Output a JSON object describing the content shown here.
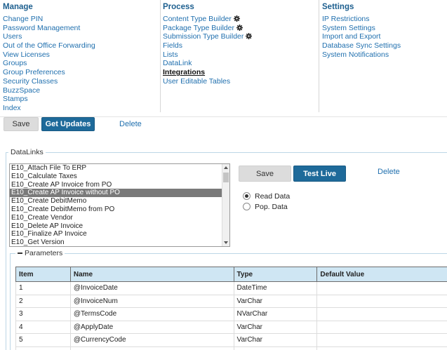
{
  "nav": {
    "manage": {
      "heading": "Manage",
      "items": [
        "Change PIN",
        "Password Management",
        "Users",
        "Out of the Office Forwarding",
        "View Licenses",
        "Groups",
        "Group Preferences",
        "Security Classes",
        "BuzzSpace",
        "Stamps",
        "Index"
      ]
    },
    "process": {
      "heading": "Process",
      "items": [
        {
          "label": "Content Type Builder",
          "icon": "gear-icon"
        },
        {
          "label": "Package Type Builder",
          "icon": "gear-icon"
        },
        {
          "label": "Submission Type Builder",
          "icon": "gear-icon"
        },
        {
          "label": "Fields"
        },
        {
          "label": "Lists"
        },
        {
          "label": "DataLink"
        },
        {
          "label": "Integrations",
          "active": true
        },
        {
          "label": "User Editable Tables"
        }
      ]
    },
    "settings": {
      "heading": "Settings",
      "items": [
        "IP Restrictions",
        "System Settings",
        "Import and Export",
        "Database Sync Settings",
        "System Notifications"
      ]
    }
  },
  "toolbar": {
    "save_label": "Save",
    "get_updates_label": "Get Updates",
    "delete_label": "Delete"
  },
  "datalinks": {
    "legend": "DataLinks",
    "items": [
      "E10_Attach File To ERP",
      "E10_Calculate Taxes",
      "E10_Create AP Invoice from PO",
      "E10_Create AP Invoice without PO",
      "E10_Create DebitMemo",
      "E10_Create DebitMemo from PO",
      "E10_Create Vendor",
      "E10_Delete AP Invoice",
      "E10_Finalize AP Invoice",
      "E10_Get Version"
    ],
    "selected": "E10_Create AP Invoice without PO",
    "save_label": "Save",
    "test_live_label": "Test Live",
    "delete_label": "Delete",
    "radio": {
      "read_label": "Read Data",
      "pop_label": "Pop. Data",
      "selected": "Read Data"
    }
  },
  "parameters": {
    "legend": "Parameters",
    "columns": [
      "Item",
      "Name",
      "Type",
      "Default Value"
    ],
    "rows": [
      [
        "1",
        "@InvoiceDate",
        "DateTime",
        ""
      ],
      [
        "2",
        "@InvoiceNum",
        "VarChar",
        ""
      ],
      [
        "3",
        "@TermsCode",
        "NVarChar",
        ""
      ],
      [
        "4",
        "@ApplyDate",
        "VarChar",
        ""
      ],
      [
        "5",
        "@CurrencyCode",
        "VarChar",
        ""
      ],
      [
        "",
        "",
        "",
        ""
      ]
    ]
  },
  "colors": {
    "accent_blue": "#1e6a9a",
    "link_blue": "#1f6fae",
    "header_bg": "#cfe6f3",
    "selection_grey": "#7a7a7a"
  }
}
